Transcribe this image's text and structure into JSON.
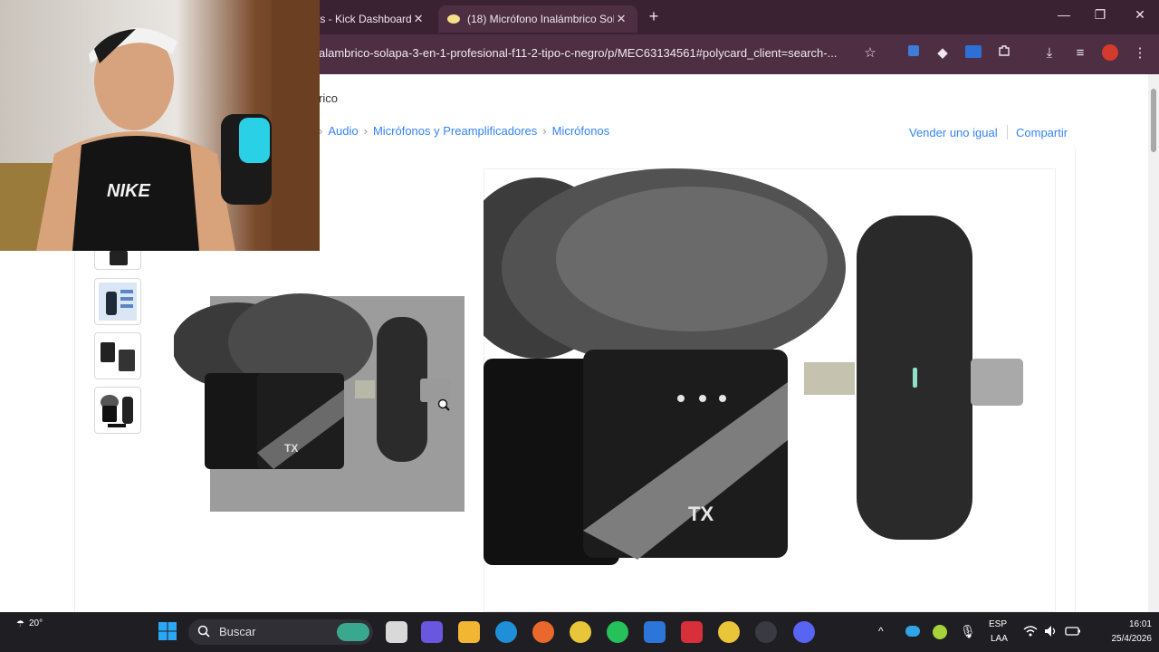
{
  "browser": {
    "tabs": [
      {
        "label": "ts - Kick Dashboard",
        "close": "✕"
      },
      {
        "label": "(18) Micrófono Inalámbrico Sol",
        "close": "✕"
      }
    ],
    "new_tab": "+",
    "window_controls": [
      "—",
      "❐",
      "✕"
    ],
    "url": "alambrico-solapa-3-en-1-profesional-f11-2-tipo-c-negro/p/MEC63134561#polycard_client=search-..."
  },
  "page": {
    "category_fragment": "rico",
    "breadcrumb": [
      "Audio",
      "Micrófonos y Preamplificadores",
      "Micrófonos"
    ],
    "actions": {
      "sell": "Vender uno igual",
      "share": "Compartir"
    },
    "product_badge": "TX",
    "accent": "#3483fa"
  },
  "webcam": {
    "shirt_text": "NIKE"
  },
  "taskbar": {
    "weather": "20°",
    "search_placeholder": "Buscar",
    "lang_top": "ESP",
    "lang_bottom": "LAA",
    "time": "16:01",
    "date": "25/4/2026",
    "chevron": "^"
  }
}
